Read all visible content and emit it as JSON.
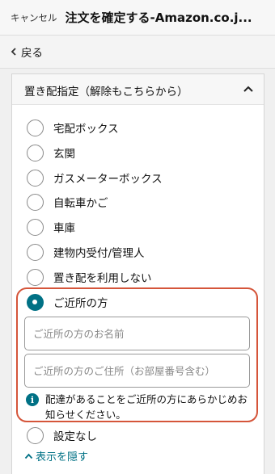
{
  "header": {
    "cancel_label": "キャンセル",
    "title": "注文を確定する-Amazon.co.j..."
  },
  "nav": {
    "back_label": "戻る"
  },
  "section": {
    "title": "置き配指定（解除もこちらから）",
    "options": [
      {
        "label": "宅配ボックス",
        "selected": false
      },
      {
        "label": "玄関",
        "selected": false
      },
      {
        "label": "ガスメーターボックス",
        "selected": false
      },
      {
        "label": "自転車かご",
        "selected": false
      },
      {
        "label": "車庫",
        "selected": false
      },
      {
        "label": "建物内受付/管理人",
        "selected": false
      },
      {
        "label": "置き配を利用しない",
        "selected": false
      },
      {
        "label": "ご近所の方",
        "selected": true
      },
      {
        "label": "設定なし",
        "selected": false
      }
    ],
    "neighbor": {
      "name_placeholder": "ご近所の方のお名前",
      "address_placeholder": "ご近所の方のご住所（お部屋番号含む）",
      "notice": "配達があることをご近所の方にあらかじめお知らせください。"
    },
    "hide_label": "表示を隠す"
  },
  "colors": {
    "accent": "#007185",
    "highlight_border": "#d5553a"
  }
}
